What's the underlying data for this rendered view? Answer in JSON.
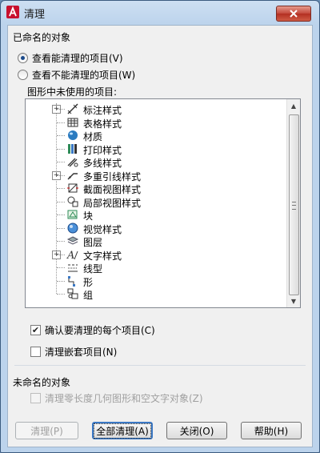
{
  "window": {
    "title": "清理"
  },
  "named_section": {
    "label": "已命名的对象",
    "radio_view_purgeable": "查看能清理的项目(V)",
    "radio_view_unpurgeable": "查看不能清理的项目(W)",
    "list_label": "图形中未使用的项目:"
  },
  "tree": [
    {
      "label": "标注样式",
      "icon": "dimension-style-icon",
      "expandable": true
    },
    {
      "label": "表格样式",
      "icon": "table-style-icon",
      "expandable": false
    },
    {
      "label": "材质",
      "icon": "material-icon",
      "expandable": false
    },
    {
      "label": "打印样式",
      "icon": "plot-style-icon",
      "expandable": false
    },
    {
      "label": "多线样式",
      "icon": "multiline-style-icon",
      "expandable": false
    },
    {
      "label": "多重引线样式",
      "icon": "multileader-style-icon",
      "expandable": true
    },
    {
      "label": "截面视图样式",
      "icon": "section-view-style-icon",
      "expandable": false
    },
    {
      "label": "局部视图样式",
      "icon": "detail-view-style-icon",
      "expandable": false
    },
    {
      "label": "块",
      "icon": "block-icon",
      "expandable": false
    },
    {
      "label": "视觉样式",
      "icon": "visual-style-icon",
      "expandable": false
    },
    {
      "label": "图层",
      "icon": "layer-icon",
      "expandable": false
    },
    {
      "label": "文字样式",
      "icon": "text-style-icon",
      "expandable": true
    },
    {
      "label": "线型",
      "icon": "linetype-icon",
      "expandable": false
    },
    {
      "label": "形",
      "icon": "shape-icon",
      "expandable": false
    },
    {
      "label": "组",
      "icon": "group-icon",
      "expandable": false
    }
  ],
  "options": {
    "confirm_each": "确认要清理的每个项目(C)",
    "purge_nested": "清理嵌套项目(N)"
  },
  "unnamed_section": {
    "label": "未命名的对象",
    "purge_zero_length": "清理零长度几何图形和空文字对象(Z)"
  },
  "buttons": {
    "purge": "清理(P)",
    "purge_all": "全部清理(A)",
    "close": "关闭(O)",
    "help": "帮助(H)"
  },
  "colors": {
    "accent": "#3a78c4",
    "close_button": "#c3473a",
    "title_bar": "#bcd3ec"
  }
}
